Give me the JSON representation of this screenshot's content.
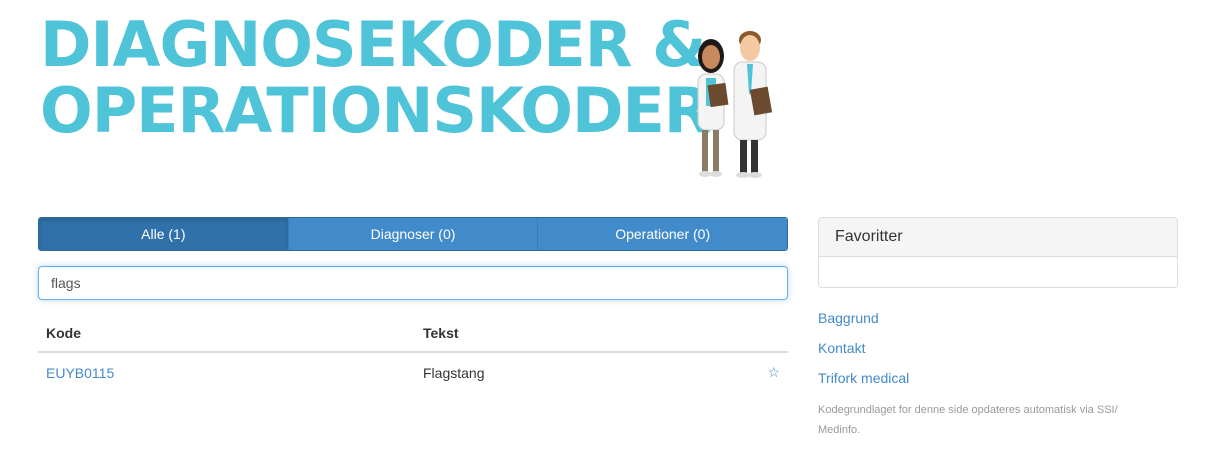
{
  "header": {
    "title_line1": "DIAGNOSEKODER &",
    "title_line2": "OPERATIONSKODER"
  },
  "tabs": [
    {
      "label": "Alle (1)",
      "active": true
    },
    {
      "label": "Diagnoser (0)",
      "active": false
    },
    {
      "label": "Operationer (0)",
      "active": false
    }
  ],
  "search": {
    "value": "flags"
  },
  "table": {
    "headers": [
      "Kode",
      "Tekst"
    ],
    "rows": [
      {
        "code": "EUYB0115",
        "text": "Flagstang",
        "favorite_icon": "star-outline-icon"
      }
    ]
  },
  "favorites": {
    "title": "Favoritter"
  },
  "links": [
    "Baggrund",
    "Kontakt",
    "Trifork medical"
  ],
  "footnote": "Kodegrundlaget for denne side opdateres automatisk via SSI/ Medinfo.",
  "colors": {
    "brand": "#4fc4d9",
    "primary": "#428bca",
    "active_tab": "#3071a9"
  }
}
